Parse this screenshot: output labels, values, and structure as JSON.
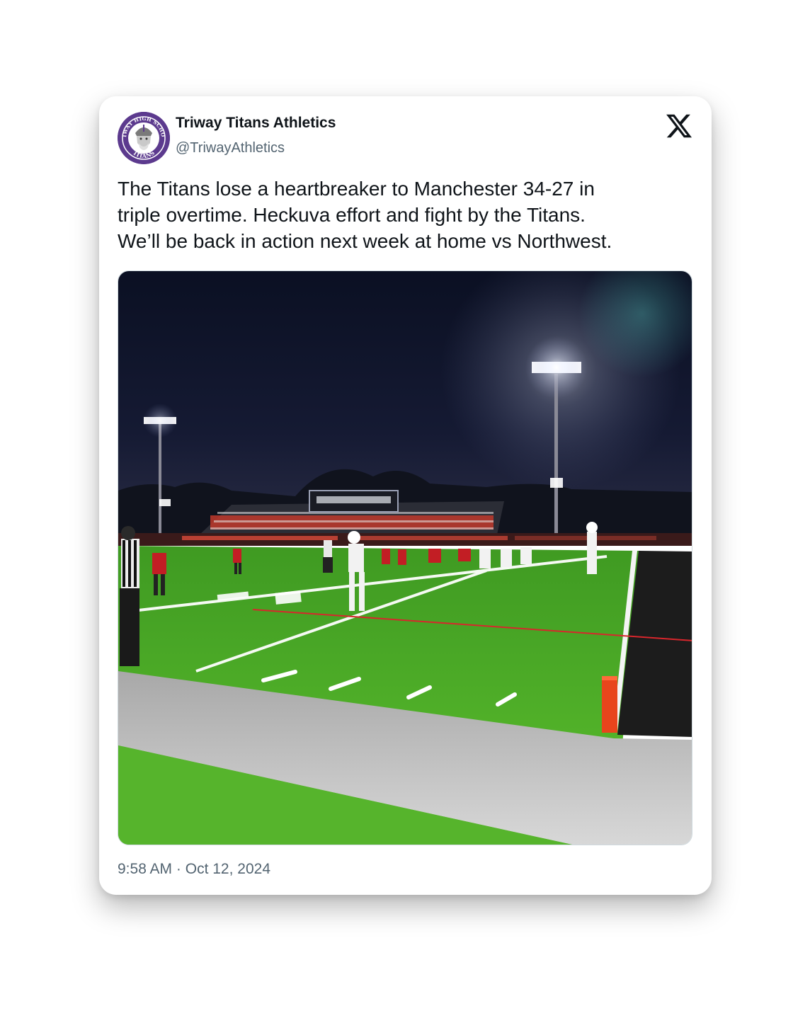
{
  "tweet": {
    "display_name": "Triway Titans Athletics",
    "handle": "@TriwayAthletics",
    "text": "The Titans lose a heartbreaker to Manchester 34-27 in\ntriple overtime. Heckuva effort and fight by the Titans.\nWe’ll be back in action next week at home vs Northwest.",
    "time": "9:58 AM",
    "separator": "·",
    "date": "Oct 12, 2024"
  },
  "avatar": {
    "icon": "titans-logo-icon",
    "ring_text_top": "TRIWAY HIGH SCHOOL",
    "ring_text_bottom": "TITANS",
    "ring_color": "#5c3a8e"
  },
  "brand": {
    "icon": "x-logo-icon"
  },
  "media": {
    "icon": "football-field-photo",
    "description_colors": {
      "sky": "#0d1226",
      "turf": "#4fb02a",
      "endzone_sideline": "#1e1e1e",
      "pylon": "#e8451c"
    }
  },
  "colors": {
    "text_primary": "#0f1419",
    "text_secondary": "#536471",
    "border": "#cfd9de"
  }
}
